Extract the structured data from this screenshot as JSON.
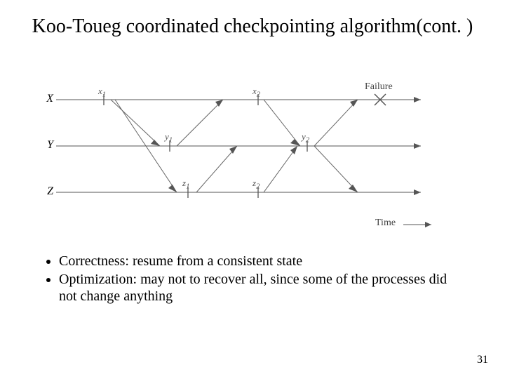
{
  "title": "Koo-Toueg coordinated checkpointing algorithm(cont. )",
  "diagram": {
    "processes": [
      "X",
      "Y",
      "Z"
    ],
    "events": {
      "x1": "x",
      "x1sub": "1",
      "x2": "x",
      "x2sub": "2",
      "y1": "y",
      "y1sub": "1",
      "y2": "y",
      "y2sub": "2",
      "z1": "z",
      "z1sub": "1",
      "z2": "z",
      "z2sub": "2"
    },
    "failure": "Failure",
    "time": "Time"
  },
  "bullets": [
    "Correctness: resume from a consistent state",
    "Optimization: may not to recover all, since some of the processes did not change anything"
  ],
  "page": "31"
}
